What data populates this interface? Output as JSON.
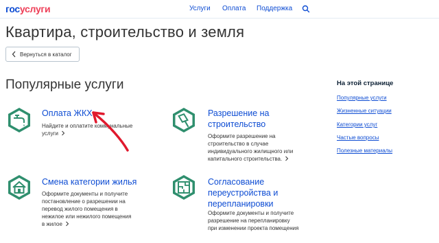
{
  "header": {
    "logo_left": "гос",
    "logo_right": "услуги",
    "nav": [
      "Услуги",
      "Оплата",
      "Поддержка"
    ]
  },
  "page": {
    "title": "Квартира, строительство и земля",
    "back_label": "Вернуться в каталог",
    "section_title": "Популярные услуги"
  },
  "services": [
    {
      "title_lines": [
        "Оплата ЖКХ"
      ],
      "desc_lines": [
        "Найдите и оплатите коммунальные",
        "услуги"
      ],
      "icon": "faucet-icon"
    },
    {
      "title_lines": [
        "Разрешение на",
        "строительство"
      ],
      "desc_lines": [
        "Оформите разрешение на",
        "строительство в случае",
        "индивидуального жилищного или",
        "капитального строительства."
      ],
      "icon": "trowel-icon"
    },
    {
      "title_lines": [
        "Смена категории жилья"
      ],
      "desc_lines": [
        "Оформите документы и получите",
        "постановление о разрешении на",
        "перевод жилого помещения в",
        "нежилое или нежилого помещения",
        "в жилое"
      ],
      "icon": "house-icon"
    },
    {
      "title_lines": [
        "Согласование",
        "переустройства и",
        "перепланировки"
      ],
      "desc_lines": [
        "Оформите документы и получите",
        "разрешение на перепланировку",
        "при изменении проекта помещения"
      ],
      "icon": "floorplan-icon"
    }
  ],
  "toc": {
    "heading": "На этой странице",
    "links": [
      "Популярные услуги",
      "Жизненные ситуации",
      "Категории услуг",
      "Частые вопросы",
      "Полезные материалы"
    ]
  },
  "colors": {
    "link": "#0d4cd3",
    "accent_red": "#ee3f58",
    "icon_green": "#2f8f6e",
    "annotation_arrow": "#e0192d"
  }
}
